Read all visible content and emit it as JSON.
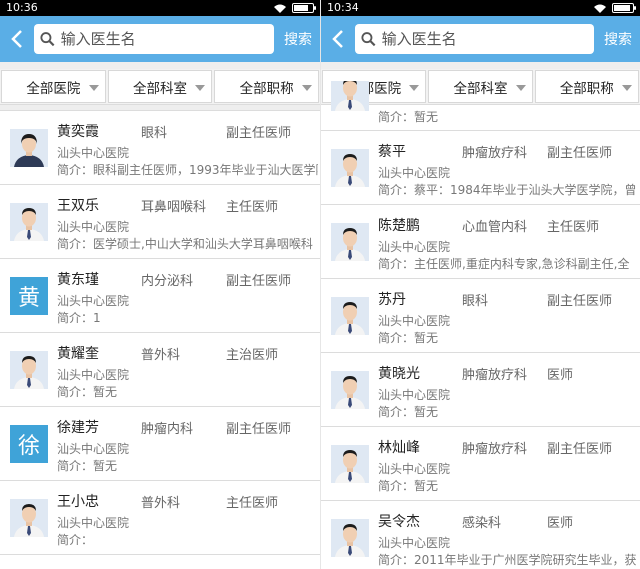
{
  "screens": [
    {
      "status": {
        "time": "10:36"
      },
      "search": {
        "placeholder": "输入医生名",
        "button": "搜索"
      },
      "filters": [
        "全部医院",
        "全部科室",
        "全部职称"
      ],
      "doctors": [
        {
          "name": "黄奕霞",
          "dept": "眼科",
          "title": "副主任医师",
          "hospital": "汕头中心医院",
          "intro": "简介：眼科副主任医师，1993年毕业于汕大医学院，",
          "avatar": "photo-f"
        },
        {
          "name": "王双乐",
          "dept": "耳鼻咽喉科",
          "title": "主任医师",
          "hospital": "汕头中心医院",
          "intro": "简介：医学硕士,中山大学和汕头大学耳鼻咽喉科",
          "avatar": "photo-m"
        },
        {
          "name": "黄东瑾",
          "dept": "内分泌科",
          "title": "副主任医师",
          "hospital": "汕头中心医院",
          "intro": "简介：1",
          "avatar": "letter",
          "letter": "黄"
        },
        {
          "name": "黄耀奎",
          "dept": "普外科",
          "title": "主治医师",
          "hospital": "汕头中心医院",
          "intro": "简介：暂无",
          "avatar": "photo-m"
        },
        {
          "name": "徐建芳",
          "dept": "肿瘤内科",
          "title": "副主任医师",
          "hospital": "汕头中心医院",
          "intro": "简介：暂无",
          "avatar": "letter",
          "letter": "徐"
        },
        {
          "name": "王小忠",
          "dept": "普外科",
          "title": "主任医师",
          "hospital": "汕头中心医院",
          "intro": "简介：",
          "avatar": "photo-m"
        }
      ]
    },
    {
      "status": {
        "time": "10:34"
      },
      "search": {
        "placeholder": "输入医生名",
        "button": "搜索"
      },
      "filters": [
        "全部医院",
        "全部科室",
        "全部职称"
      ],
      "partial_intro": "简介：暂无",
      "doctors": [
        {
          "name": "蔡平",
          "dept": "肿瘤放疗科",
          "title": "副主任医师",
          "hospital": "汕头中心医院",
          "intro": "简介：蔡平：1984年毕业于汕头大学医学院，曾",
          "avatar": "photo-m"
        },
        {
          "name": "陈楚鹏",
          "dept": "心血管内科",
          "title": "主任医师",
          "hospital": "汕头中心医院",
          "intro": "简介：主任医师,重症内科专家,急诊科副主任,全",
          "avatar": "photo-m"
        },
        {
          "name": "苏丹",
          "dept": "眼科",
          "title": "副主任医师",
          "hospital": "汕头中心医院",
          "intro": "简介：暂无",
          "avatar": "photo-m"
        },
        {
          "name": "黄晓光",
          "dept": "肿瘤放疗科",
          "title": "医师",
          "hospital": "汕头中心医院",
          "intro": "简介：暂无",
          "avatar": "photo-m"
        },
        {
          "name": "林灿峰",
          "dept": "肿瘤放疗科",
          "title": "副主任医师",
          "hospital": "汕头中心医院",
          "intro": "简介：暂无",
          "avatar": "photo-m"
        },
        {
          "name": "吴令杰",
          "dept": "感染科",
          "title": "医师",
          "hospital": "汕头中心医院",
          "intro": "简介：2011年毕业于广州医学院研究生毕业，获",
          "avatar": "photo-m"
        }
      ]
    }
  ],
  "colors": {
    "header": "#5aaee6",
    "letter_avatar": "#3fa3d8"
  }
}
